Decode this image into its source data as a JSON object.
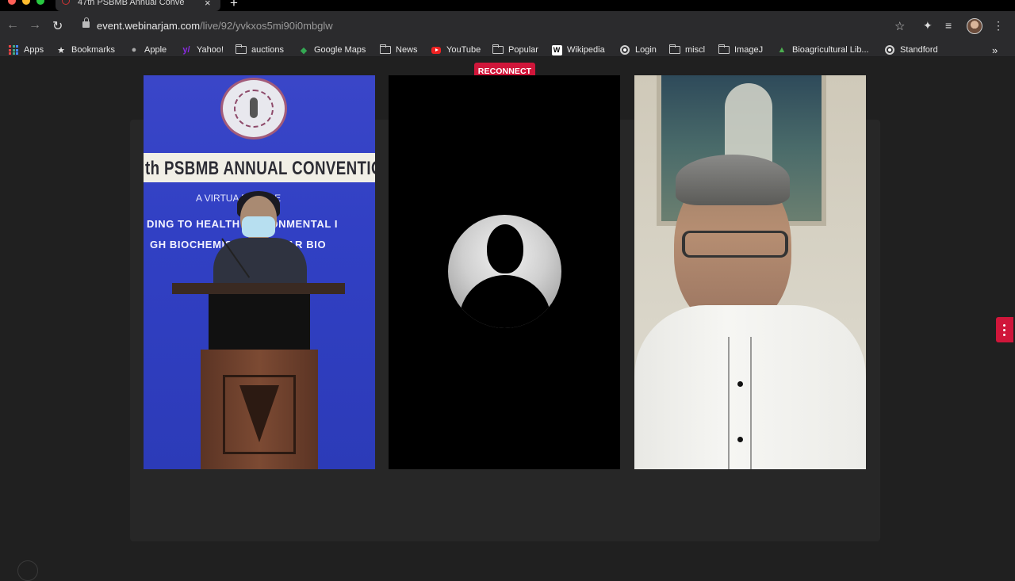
{
  "browser": {
    "tab_title": "47th PSBMB Annual Conve",
    "tab_close": "×",
    "new_tab": "+",
    "url_host": "event.webinarjam.com",
    "url_path": "/live/92/yvkxos5mi90i0mbglw",
    "nav": {
      "back": "←",
      "forward": "→",
      "reload": "↻"
    },
    "icons": {
      "star": "☆",
      "extensions": "✦",
      "reading_list": "≡",
      "menu": "⋮"
    }
  },
  "bookmarks": {
    "items": [
      {
        "label": "Apps",
        "icon": "apps-grid-icon"
      },
      {
        "label": "Bookmarks",
        "icon": "star-icon"
      },
      {
        "label": "Apple",
        "icon": "apple-icon"
      },
      {
        "label": "Yahoo!",
        "icon": "yahoo-icon"
      },
      {
        "label": "auctions",
        "icon": "folder-icon"
      },
      {
        "label": "Google Maps",
        "icon": "maps-icon"
      },
      {
        "label": "News",
        "icon": "folder-icon"
      },
      {
        "label": "YouTube",
        "icon": "youtube-icon"
      },
      {
        "label": "Popular",
        "icon": "folder-icon"
      },
      {
        "label": "Wikipedia",
        "icon": "wikipedia-icon"
      },
      {
        "label": "Login",
        "icon": "globe-icon"
      },
      {
        "label": "miscl",
        "icon": "folder-icon"
      },
      {
        "label": "ImageJ",
        "icon": "folder-icon"
      },
      {
        "label": "Bioagricultural Lib...",
        "icon": "leaf-icon"
      },
      {
        "label": "Standford",
        "icon": "globe-icon"
      }
    ],
    "overflow": "»"
  },
  "webinar": {
    "reconnect_label": "RECONNECT",
    "tile1": {
      "banner": "th PSBMB ANNUAL CONVENTIO",
      "subtitle": "A VIRTUA       ERENCE",
      "line1": "DING TO HEALTH       NVIRONMENTAL I",
      "line2": "GH BIOCHEMISTR       LECULAR BIO"
    }
  },
  "colors": {
    "accent_red": "#d0163a",
    "banner_blue": "#3140c4",
    "chrome_bg": "#2b2b2d",
    "stage_bg": "#202020"
  }
}
